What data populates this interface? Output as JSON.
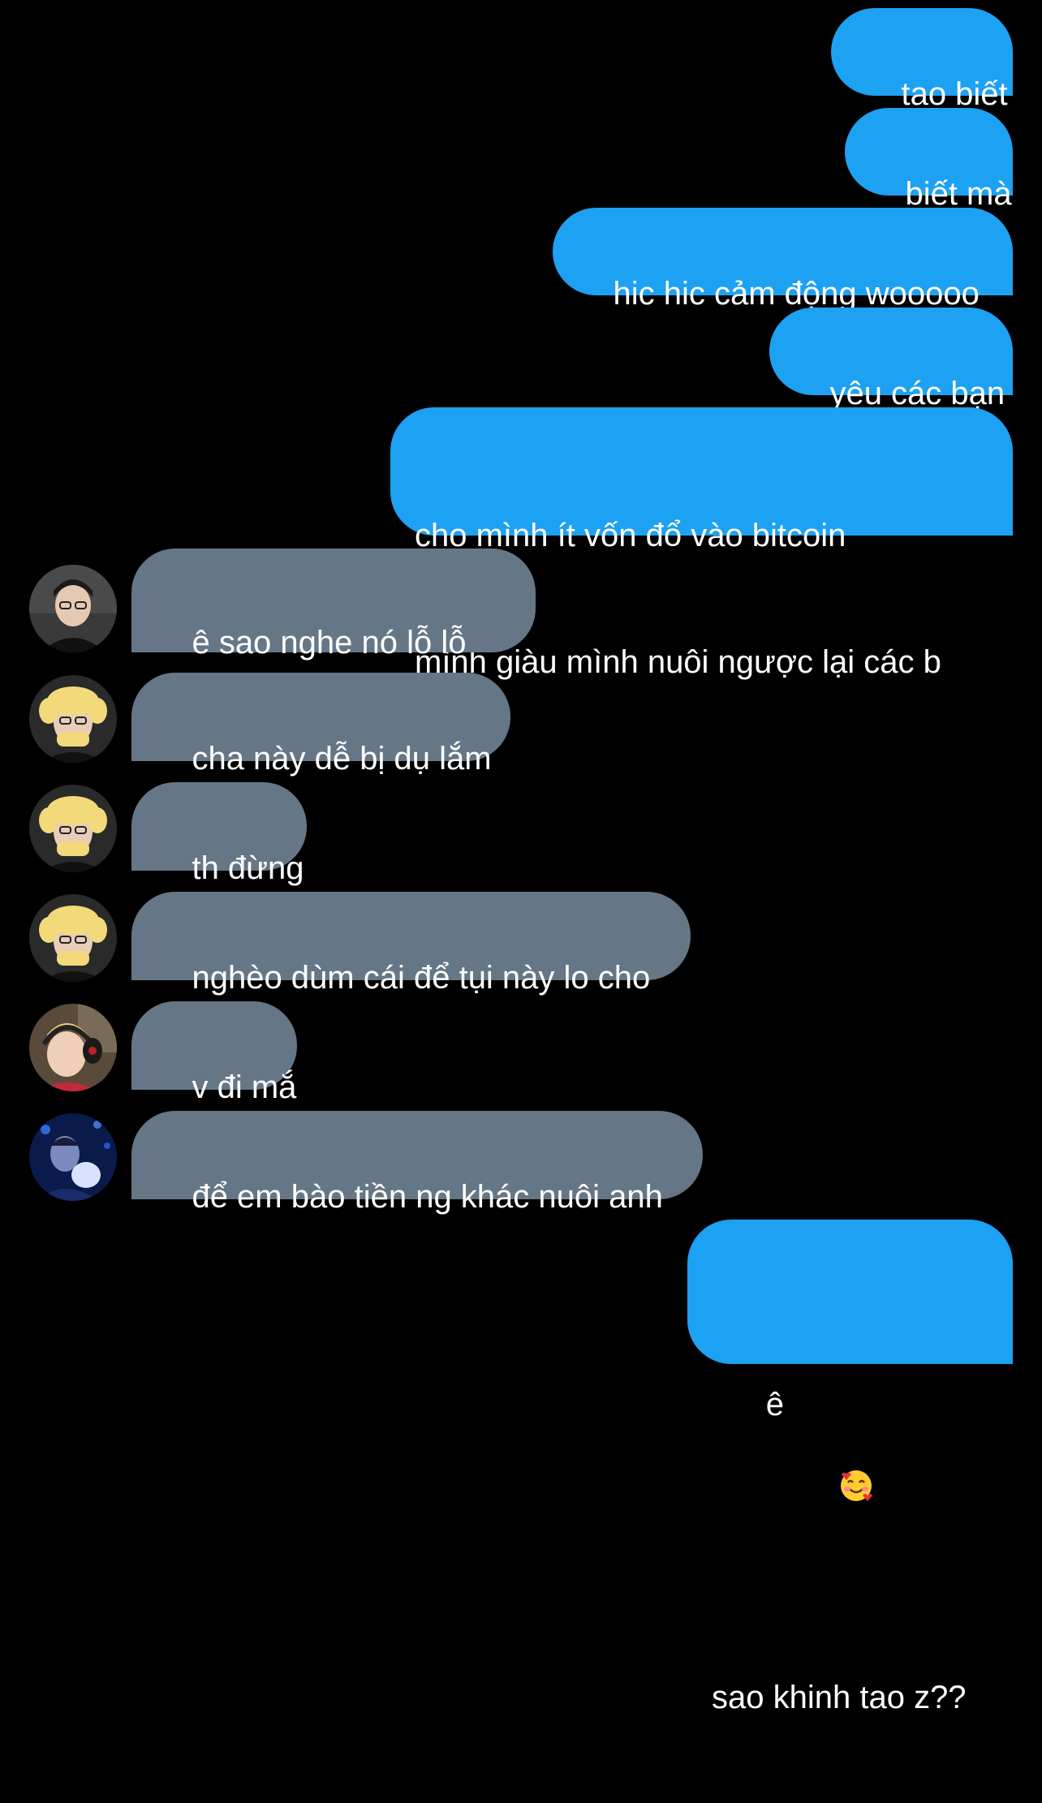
{
  "colors": {
    "background": "#000000",
    "sent_bubble": "#1da1f2",
    "received_bubble": "#657786",
    "text": "#ffffff"
  },
  "messages": [
    {
      "side": "sent",
      "text": "tao biết"
    },
    {
      "side": "sent",
      "text": "biết mà"
    },
    {
      "side": "sent",
      "text": "hic hic cảm động wooooo"
    },
    {
      "side": "sent",
      "text": "yêu các bạn"
    },
    {
      "side": "sent",
      "lines": [
        "cho mình ít vốn đổ vào bitcoin",
        "mình giàu mình nuôi ngược lại các b"
      ]
    },
    {
      "side": "received",
      "avatar": "user-avatar-1",
      "text": "ê sao nghe nó lỗ lỗ",
      "emoji": "smiling-face-with-hearts"
    },
    {
      "side": "received",
      "avatar": "user-avatar-2",
      "text": "cha này dễ bị dụ lắm"
    },
    {
      "side": "received",
      "avatar": "user-avatar-2",
      "text": "th đừng"
    },
    {
      "side": "received",
      "avatar": "user-avatar-2",
      "text": "nghèo dùm cái để tụi này lo cho"
    },
    {
      "side": "received",
      "avatar": "user-avatar-3",
      "text": "v đi mắ"
    },
    {
      "side": "received",
      "avatar": "user-avatar-4",
      "text": "để em bào tiền ng khác nuôi anh"
    },
    {
      "side": "sent",
      "lines": [
        "ê",
        "sao khinh tao z??"
      ],
      "emoji": "smiling-face-with-hearts"
    }
  ]
}
